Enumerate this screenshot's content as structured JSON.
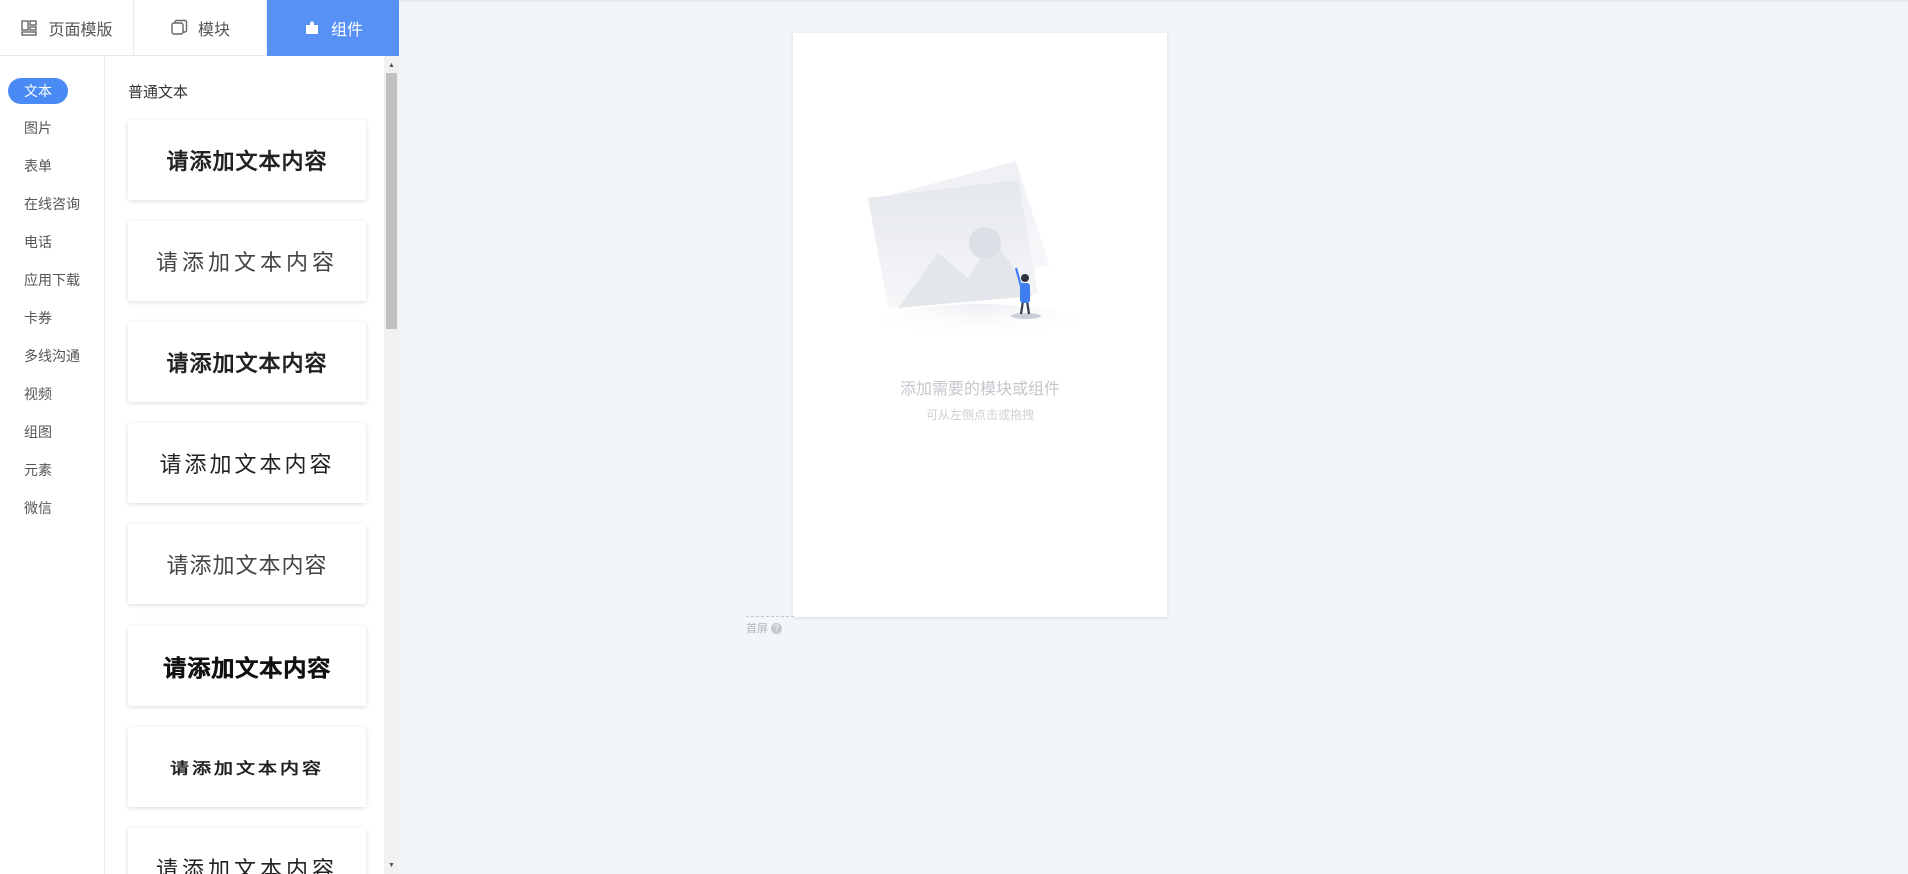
{
  "tabs": [
    {
      "label": "页面模版",
      "icon": "page-template-icon",
      "active": false
    },
    {
      "label": "模块",
      "icon": "module-icon",
      "active": false
    },
    {
      "label": "组件",
      "icon": "component-icon",
      "active": true
    }
  ],
  "categories": [
    "文本",
    "图片",
    "表单",
    "在线咨询",
    "电话",
    "应用下载",
    "卡券",
    "多线沟通",
    "视频",
    "组图",
    "元素",
    "微信"
  ],
  "active_category": "文本",
  "section_title": "普通文本",
  "text_samples": [
    "请添加文本内容",
    "请添加文本内容",
    "请添加文本内容",
    "请添加文本内容",
    "请添加文本内容",
    "请添加文本内容",
    "请添加文本内容",
    "请添加文本内容"
  ],
  "canvas": {
    "empty_title": "添加需要的模块或组件",
    "empty_subtitle": "可从左侧点击或拖拽"
  },
  "first_screen": {
    "label": "首屏",
    "help": "?"
  },
  "colors": {
    "accent": "#5891f6",
    "background": "#f3f6f9"
  }
}
